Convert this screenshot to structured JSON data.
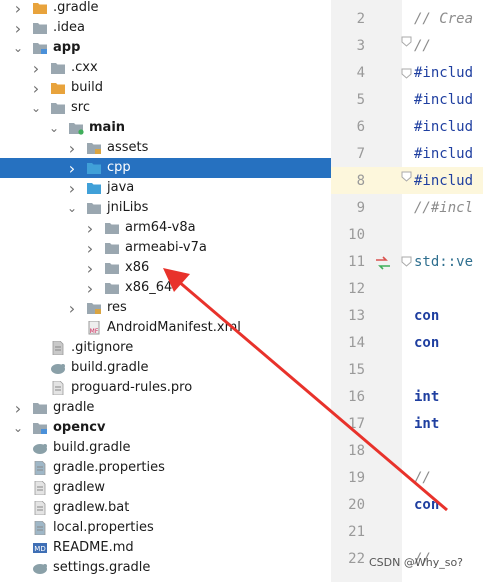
{
  "tree": [
    {
      "label": ".gradle",
      "indent": 0,
      "arrow": "collapsed",
      "icon": "folder-orange-icon"
    },
    {
      "label": ".idea",
      "indent": 0,
      "arrow": "collapsed",
      "icon": "folder-gray-icon"
    },
    {
      "label": "app",
      "indent": 0,
      "arrow": "expanded",
      "icon": "module-folder-icon",
      "bold": true
    },
    {
      "label": ".cxx",
      "indent": 1,
      "arrow": "collapsed",
      "icon": "folder-gray-icon"
    },
    {
      "label": "build",
      "indent": 1,
      "arrow": "collapsed",
      "icon": "folder-orange-icon"
    },
    {
      "label": "src",
      "indent": 1,
      "arrow": "expanded",
      "icon": "folder-gray-icon"
    },
    {
      "label": "main",
      "indent": 2,
      "arrow": "expanded",
      "icon": "source-root-folder-icon",
      "bold": true
    },
    {
      "label": "assets",
      "indent": 3,
      "arrow": "collapsed",
      "icon": "resources-folder-icon"
    },
    {
      "label": "cpp",
      "indent": 3,
      "arrow": "collapsed",
      "icon": "folder-blue-icon",
      "selected": true
    },
    {
      "label": "java",
      "indent": 3,
      "arrow": "collapsed",
      "icon": "folder-blue-icon"
    },
    {
      "label": "jniLibs",
      "indent": 3,
      "arrow": "expanded",
      "icon": "folder-gray-icon"
    },
    {
      "label": "arm64-v8a",
      "indent": 4,
      "arrow": "collapsed",
      "icon": "folder-gray-icon"
    },
    {
      "label": "armeabi-v7a",
      "indent": 4,
      "arrow": "collapsed",
      "icon": "folder-gray-icon"
    },
    {
      "label": "x86",
      "indent": 4,
      "arrow": "collapsed",
      "icon": "folder-gray-icon"
    },
    {
      "label": "x86_64",
      "indent": 4,
      "arrow": "collapsed",
      "icon": "folder-gray-icon"
    },
    {
      "label": "res",
      "indent": 3,
      "arrow": "collapsed",
      "icon": "resources-folder-icon"
    },
    {
      "label": "AndroidManifest.xml",
      "indent": 3,
      "arrow": "none",
      "icon": "manifest-file-icon"
    },
    {
      "label": ".gitignore",
      "indent": 1,
      "arrow": "none",
      "icon": "gitignore-file-icon"
    },
    {
      "label": "build.gradle",
      "indent": 1,
      "arrow": "none",
      "icon": "gradle-file-icon"
    },
    {
      "label": "proguard-rules.pro",
      "indent": 1,
      "arrow": "none",
      "icon": "text-file-icon"
    },
    {
      "label": "gradle",
      "indent": 0,
      "arrow": "collapsed",
      "icon": "folder-gray-icon"
    },
    {
      "label": "opencv",
      "indent": 0,
      "arrow": "expanded",
      "icon": "module-folder-icon",
      "bold": true
    },
    {
      "label": "build.gradle",
      "indent": 0,
      "arrow": "none",
      "icon": "gradle-file-icon"
    },
    {
      "label": "gradle.properties",
      "indent": 0,
      "arrow": "none",
      "icon": "properties-file-icon"
    },
    {
      "label": "gradlew",
      "indent": 0,
      "arrow": "none",
      "icon": "script-file-icon"
    },
    {
      "label": "gradlew.bat",
      "indent": 0,
      "arrow": "none",
      "icon": "script-file-icon"
    },
    {
      "label": "local.properties",
      "indent": 0,
      "arrow": "none",
      "icon": "properties-file-icon"
    },
    {
      "label": "README.md",
      "indent": 0,
      "arrow": "none",
      "icon": "markdown-file-icon"
    },
    {
      "label": "settings.gradle",
      "indent": 0,
      "arrow": "none",
      "icon": "gradle-file-icon"
    }
  ],
  "editor": {
    "lines": [
      {
        "num": "2",
        "text": "// Crea",
        "kind": "comment"
      },
      {
        "num": "3",
        "text": "//",
        "kind": "comment"
      },
      {
        "num": "4",
        "text": "#includ",
        "kind": "directive"
      },
      {
        "num": "5",
        "text": "#includ",
        "kind": "directive"
      },
      {
        "num": "6",
        "text": "#includ",
        "kind": "directive"
      },
      {
        "num": "7",
        "text": "#includ",
        "kind": "directive"
      },
      {
        "num": "8",
        "text": "#includ",
        "kind": "directive",
        "current": true
      },
      {
        "num": "9",
        "text": "//#incl",
        "kind": "comment"
      },
      {
        "num": "10",
        "text": "",
        "kind": "plain"
      },
      {
        "num": "11",
        "text": "std::ve",
        "kind": "std"
      },
      {
        "num": "12",
        "text": "",
        "kind": "plain"
      },
      {
        "num": "13",
        "text": "    con",
        "kind": "keyword"
      },
      {
        "num": "14",
        "text": "    con",
        "kind": "keyword"
      },
      {
        "num": "15",
        "text": "",
        "kind": "plain"
      },
      {
        "num": "16",
        "text": "    int",
        "kind": "keyword"
      },
      {
        "num": "17",
        "text": "    int",
        "kind": "keyword"
      },
      {
        "num": "18",
        "text": "",
        "kind": "plain"
      },
      {
        "num": "19",
        "text": "    //",
        "kind": "comment"
      },
      {
        "num": "20",
        "text": "    con",
        "kind": "keyword"
      },
      {
        "num": "21",
        "text": "",
        "kind": "plain"
      },
      {
        "num": "22",
        "text": "    //",
        "kind": "comment"
      }
    ]
  },
  "watermark": "CSDN @Why_so?",
  "colors": {
    "selection": "#2671c0",
    "annotation_arrow": "#e8322b",
    "folder_orange": "#e8a33c",
    "folder_gray": "#9aa7b0",
    "folder_blue": "#40a0d8"
  }
}
